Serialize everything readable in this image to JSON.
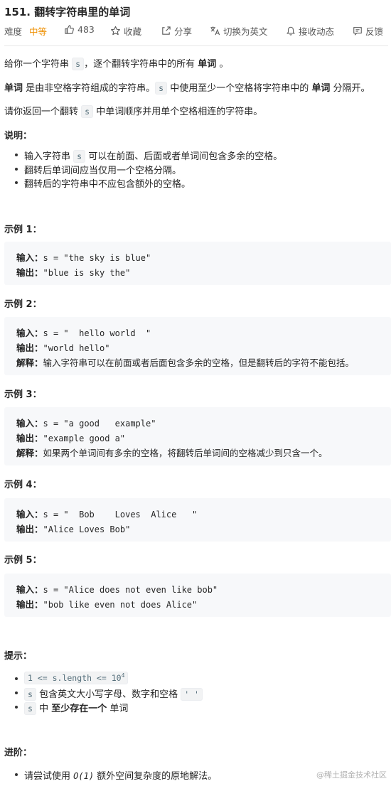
{
  "header": {
    "title": "151. 翻转字符串里的单词",
    "difficulty_label": "难度",
    "difficulty": "中等",
    "likes": "483",
    "favorite": "收藏",
    "share": "分享",
    "switch_lang": "切换为英文",
    "subscribe": "接收动态",
    "feedback": "反馈"
  },
  "description": {
    "p1_a": "给你一个字符串 ",
    "p1_code": "s",
    "p1_b": "，逐个翻转字符串中的所有 ",
    "p1_bold": "单词",
    "p1_c": " 。",
    "p2_bold": "单词",
    "p2_a": " 是由非空格字符组成的字符串。",
    "p2_code": "s",
    "p2_b": " 中使用至少一个空格将字符串中的 ",
    "p2_bold2": "单词",
    "p2_c": " 分隔开。",
    "p3_a": "请你返回一个翻转 ",
    "p3_code": "s",
    "p3_b": " 中单词顺序并用单个空格相连的字符串。"
  },
  "notes": {
    "heading": "说明：",
    "items": [
      {
        "a": "输入字符串 ",
        "code": "s",
        "b": " 可以在前面、后面或者单词间包含多余的空格。"
      },
      {
        "a": "翻转后单词间应当仅用一个空格分隔。"
      },
      {
        "a": "翻转后的字符串中不应包含额外的空格。"
      }
    ]
  },
  "examples": [
    {
      "heading": "示例 1：",
      "input_label": "输入：",
      "input": "s = \"the sky is blue\"",
      "output_label": "输出：",
      "output": "\"blue is sky the\""
    },
    {
      "heading": "示例 2：",
      "input_label": "输入：",
      "input": "s = \"  hello world  \"",
      "output_label": "输出：",
      "output": "\"world hello\"",
      "explain_label": "解释：",
      "explain": "输入字符串可以在前面或者后面包含多余的空格，但是翻转后的字符不能包括。"
    },
    {
      "heading": "示例 3：",
      "input_label": "输入：",
      "input": "s = \"a good   example\"",
      "output_label": "输出：",
      "output": "\"example good a\"",
      "explain_label": "解释：",
      "explain": "如果两个单词间有多余的空格，将翻转后单词间的空格减少到只含一个。"
    },
    {
      "heading": "示例 4：",
      "input_label": "输入：",
      "input": "s = \"  Bob    Loves  Alice   \"",
      "output_label": "输出：",
      "output": "\"Alice Loves Bob\""
    },
    {
      "heading": "示例 5：",
      "input_label": "输入：",
      "input": "s = \"Alice does not even like bob\"",
      "output_label": "输出：",
      "output": "\"bob like even not does Alice\""
    }
  ],
  "hints": {
    "heading": "提示：",
    "h1_code": "1 <= s.length <= 10",
    "h1_sup": "4",
    "h2_code": "s",
    "h2_text": " 包含英文大小写字母、数字和空格 ",
    "h2_code2": "' '",
    "h3_code": "s",
    "h3_a": " 中 ",
    "h3_bold": "至少存在一个",
    "h3_b": " 单词"
  },
  "advanced": {
    "heading": "进阶：",
    "a": "请尝试使用 ",
    "math": "O(1)",
    "b": " 额外空间复杂度的原地解法。"
  },
  "watermark": "@稀土掘金技术社区"
}
